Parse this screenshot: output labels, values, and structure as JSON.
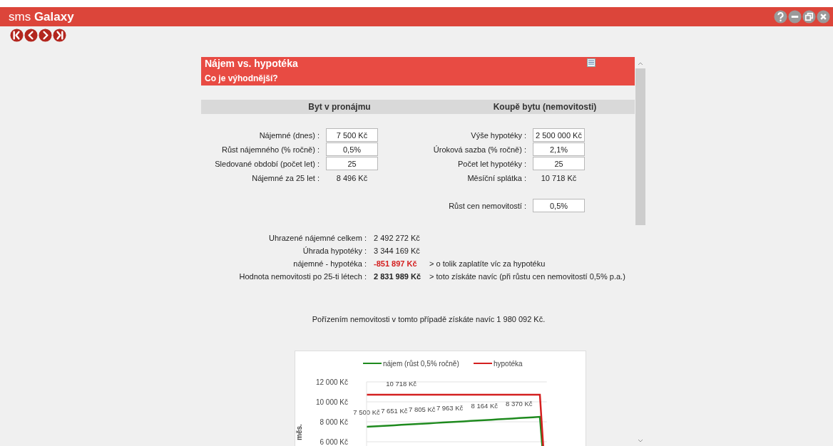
{
  "window": {
    "title": "sms **Galaxy**"
  },
  "panel": {
    "title": "Nájem vs. hypotéka",
    "subtitle": "Co je výhodnější?"
  },
  "columns": [
    "Byt v pronájmu",
    "Koupě bytu (nemovitosti)"
  ],
  "rent_fields": [
    {
      "kind": "input",
      "label": "Nájemné (dnes) :",
      "value": "7 500 Kč"
    },
    {
      "kind": "input",
      "label": "Růst nájemného (% ročně) :",
      "value": "0,5%"
    },
    {
      "kind": "input",
      "label": "Sledované období (počet let) :",
      "value": "25"
    },
    {
      "kind": "output",
      "label": "Nájemné za 25 let :",
      "value": "8 496 Kč"
    }
  ],
  "mortgage_fields": [
    {
      "kind": "input",
      "label": "Výše hypotéky :",
      "value": "2 500 000 Kč"
    },
    {
      "kind": "input",
      "label": "Úroková sazba (% ročně) :",
      "value": "2,1%"
    },
    {
      "kind": "input",
      "label": "Počet let hypotéky :",
      "value": "25"
    },
    {
      "kind": "output",
      "label": "Měsíční splátka :",
      "value": "10 718 Kč"
    }
  ],
  "growth_field": {
    "kind": "input",
    "label": "Růst cen nemovitostí :",
    "value": "0,5%"
  },
  "results": [
    {
      "kind": "plain",
      "label": "Uhrazené nájemné celkem :",
      "value": "2 492 272 Kč"
    },
    {
      "kind": "plain",
      "label": "Úhrada hypotéky :",
      "value": "3 344 169 Kč"
    },
    {
      "kind": "negative",
      "label": "nájemné - hypotéka :",
      "value": "-851 897 Kč",
      "note": "> o tolik zaplatíte víc za hypotéku"
    },
    {
      "kind": "bold",
      "label": "Hodnota nemovitosti po 25-ti létech :",
      "value": "2 831 989 Kč",
      "note": "> toto získáte navíc (při růstu cen nemovitostí 0,5% p.a.)"
    }
  ],
  "summary": "Pořízením nemovitosti v tomto případě získáte navíc 1 980 092 Kč.",
  "chart_data": {
    "type": "line",
    "ylabel": "měs.",
    "legend": "top",
    "grid": true,
    "ylim": [
      0,
      12000
    ],
    "yticks": [
      {
        "value": 6000,
        "label": "6 000 Kč"
      },
      {
        "value": 8000,
        "label": "8 000 Kč"
      },
      {
        "value": 10000,
        "label": "10 000 Kč"
      },
      {
        "value": 12000,
        "label": "12 000 Kč"
      }
    ],
    "series": [
      {
        "name": "nájem (růst 0,5% ročně)",
        "color": "#1e8a1e",
        "values": [
          7500,
          7538,
          7575,
          7613,
          7651,
          7689,
          7728,
          7766,
          7805,
          7844,
          7884,
          7923,
          7963,
          8002,
          8042,
          8083,
          8123,
          8164,
          8204,
          8245,
          8287,
          8328,
          8370,
          8412,
          8454,
          8496,
          0
        ],
        "value_labels": [
          "7 500 Kč",
          null,
          null,
          null,
          "7 651 Kč",
          null,
          null,
          null,
          "7 805 Kč",
          null,
          null,
          null,
          "7 963 Kč",
          null,
          null,
          null,
          null,
          "8 164 Kč",
          null,
          null,
          null,
          null,
          "8 370 Kč",
          null,
          null,
          null,
          null
        ]
      },
      {
        "name": "hypotéka",
        "color": "#d42020",
        "values": [
          10718,
          10718,
          10718,
          10718,
          10718,
          10718,
          10718,
          10718,
          10718,
          10718,
          10718,
          10718,
          10718,
          10718,
          10718,
          10718,
          10718,
          10718,
          10718,
          10718,
          10718,
          10718,
          10718,
          10718,
          10718,
          10718,
          0
        ],
        "value_labels": [
          null,
          null,
          null,
          null,
          null,
          "10 718 Kč",
          null,
          null,
          null,
          null,
          null,
          null,
          null,
          null,
          null,
          null,
          null,
          null,
          null,
          null,
          null,
          null,
          null,
          null,
          null,
          null,
          null
        ]
      }
    ]
  }
}
